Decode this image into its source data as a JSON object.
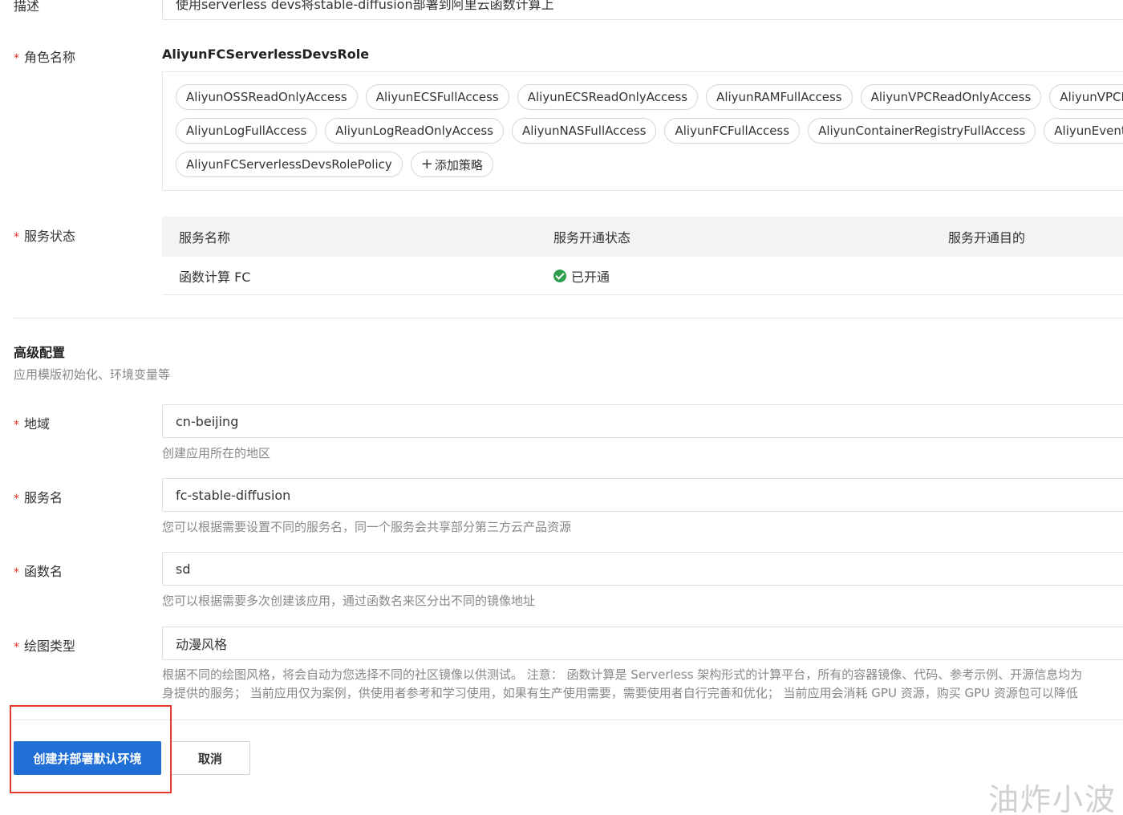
{
  "description": {
    "label": "描述",
    "value": "使用serverless devs将stable-diffusion部署到阿里云函数计算上"
  },
  "role": {
    "label": "角色名称",
    "required_mark": "*",
    "name": "AliyunFCServerlessDevsRole",
    "policies_row1": [
      "AliyunOSSReadOnlyAccess",
      "AliyunECSFullAccess",
      "AliyunECSReadOnlyAccess",
      "AliyunRAMFullAccess",
      "AliyunVPCReadOnlyAccess",
      "AliyunVPCF"
    ],
    "policies_row2": [
      "AliyunLogFullAccess",
      "AliyunLogReadOnlyAccess",
      "AliyunNASFullAccess",
      "AliyunFCFullAccess",
      "AliyunContainerRegistryFullAccess",
      "AliyunEventE"
    ],
    "policies_row3": [
      "AliyunFCServerlessDevsRolePolicy"
    ],
    "add_policy_label": "添加策略"
  },
  "service_status": {
    "label": "服务状态",
    "required_mark": "*",
    "columns": [
      "服务名称",
      "服务开通状态",
      "服务开通目的"
    ],
    "rows": [
      {
        "name": "函数计算 FC",
        "status": "已开通",
        "purpose": ""
      }
    ]
  },
  "advanced": {
    "title": "高级配置",
    "subtitle": "应用模版初始化、环境变量等"
  },
  "region": {
    "label": "地域",
    "required_mark": "*",
    "value": "cn-beijing",
    "help": "创建应用所在的地区"
  },
  "service_name": {
    "label": "服务名",
    "required_mark": "*",
    "value": "fc-stable-diffusion",
    "help": "您可以根据需要设置不同的服务名，同一个服务会共享部分第三方云产品资源"
  },
  "function_name": {
    "label": "函数名",
    "required_mark": "*",
    "value": "sd",
    "help": "您可以根据需要多次创建该应用，通过函数名来区分出不同的镜像地址"
  },
  "drawing_type": {
    "label": "绘图类型",
    "required_mark": "*",
    "value": "动漫风格",
    "help_line1": "根据不同的绘图风格，将会自动为您选择不同的社区镜像以供测试。 注意： 函数计算是 Serverless 架构形式的计算平台，所有的容器镜像、代码、参考示例、开源信息均为",
    "help_line2": "身提供的服务； 当前应用仅为案例，供使用者参考和学习使用，如果有生产使用需要，需要使用者自行完善和优化； 当前应用会消耗 GPU 资源，购买 GPU 资源包可以降低"
  },
  "actions": {
    "submit_label": "创建并部署默认环境",
    "cancel_label": "取消"
  },
  "colors": {
    "primary": "#1f6fd6",
    "required": "#e5311f",
    "success": "#2e9e4f",
    "highlight": "#e0392b"
  },
  "watermark": "油炸小波"
}
